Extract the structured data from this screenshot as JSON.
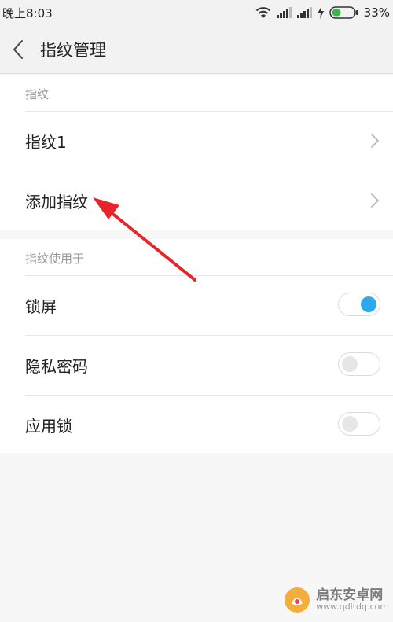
{
  "status_bar": {
    "time": "晚上8:03",
    "battery_percent": "33%",
    "icons": [
      "wifi-icon",
      "signal-icon",
      "signal-icon",
      "charging-icon",
      "battery-icon"
    ],
    "battery_color": "#3ab54a"
  },
  "nav": {
    "title": "指纹管理",
    "back_icon": "chevron-left-icon"
  },
  "section_fingerprints": {
    "header": "指纹",
    "items": [
      {
        "label": "指纹1",
        "icon": "chevron-right-icon"
      },
      {
        "label": "添加指纹",
        "icon": "chevron-right-icon"
      }
    ]
  },
  "section_usage": {
    "header": "指纹使用于",
    "items": [
      {
        "label": "锁屏",
        "toggle_on": true
      },
      {
        "label": "隐私密码",
        "toggle_on": false
      },
      {
        "label": "应用锁",
        "toggle_on": false
      }
    ]
  },
  "colors": {
    "toggle_on": "#2fa8ec",
    "annotation_arrow": "#e8232a"
  },
  "watermark": {
    "name": "启东安卓网",
    "url": "www.qdltdq.com"
  }
}
